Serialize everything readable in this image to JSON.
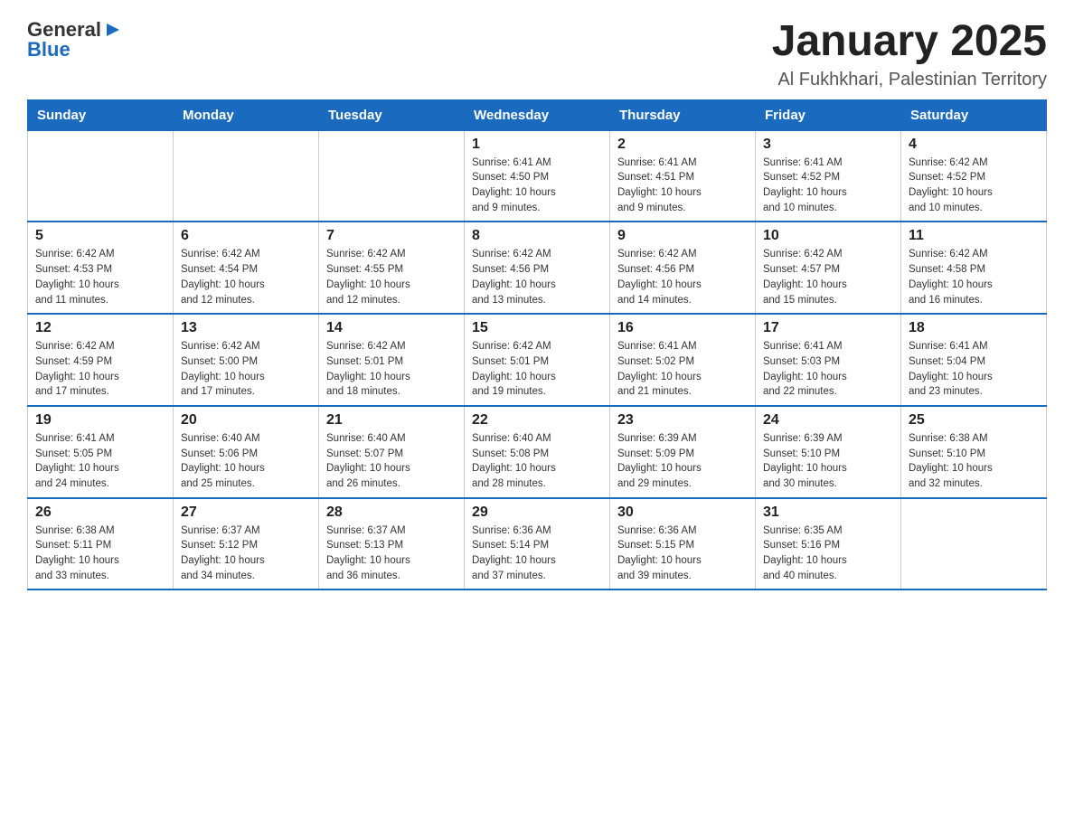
{
  "header": {
    "logo_general": "General",
    "logo_blue": "Blue",
    "month_title": "January 2025",
    "location": "Al Fukhkhari, Palestinian Territory"
  },
  "days_of_week": [
    "Sunday",
    "Monday",
    "Tuesday",
    "Wednesday",
    "Thursday",
    "Friday",
    "Saturday"
  ],
  "weeks": [
    [
      {
        "day": "",
        "info": ""
      },
      {
        "day": "",
        "info": ""
      },
      {
        "day": "",
        "info": ""
      },
      {
        "day": "1",
        "info": "Sunrise: 6:41 AM\nSunset: 4:50 PM\nDaylight: 10 hours\nand 9 minutes."
      },
      {
        "day": "2",
        "info": "Sunrise: 6:41 AM\nSunset: 4:51 PM\nDaylight: 10 hours\nand 9 minutes."
      },
      {
        "day": "3",
        "info": "Sunrise: 6:41 AM\nSunset: 4:52 PM\nDaylight: 10 hours\nand 10 minutes."
      },
      {
        "day": "4",
        "info": "Sunrise: 6:42 AM\nSunset: 4:52 PM\nDaylight: 10 hours\nand 10 minutes."
      }
    ],
    [
      {
        "day": "5",
        "info": "Sunrise: 6:42 AM\nSunset: 4:53 PM\nDaylight: 10 hours\nand 11 minutes."
      },
      {
        "day": "6",
        "info": "Sunrise: 6:42 AM\nSunset: 4:54 PM\nDaylight: 10 hours\nand 12 minutes."
      },
      {
        "day": "7",
        "info": "Sunrise: 6:42 AM\nSunset: 4:55 PM\nDaylight: 10 hours\nand 12 minutes."
      },
      {
        "day": "8",
        "info": "Sunrise: 6:42 AM\nSunset: 4:56 PM\nDaylight: 10 hours\nand 13 minutes."
      },
      {
        "day": "9",
        "info": "Sunrise: 6:42 AM\nSunset: 4:56 PM\nDaylight: 10 hours\nand 14 minutes."
      },
      {
        "day": "10",
        "info": "Sunrise: 6:42 AM\nSunset: 4:57 PM\nDaylight: 10 hours\nand 15 minutes."
      },
      {
        "day": "11",
        "info": "Sunrise: 6:42 AM\nSunset: 4:58 PM\nDaylight: 10 hours\nand 16 minutes."
      }
    ],
    [
      {
        "day": "12",
        "info": "Sunrise: 6:42 AM\nSunset: 4:59 PM\nDaylight: 10 hours\nand 17 minutes."
      },
      {
        "day": "13",
        "info": "Sunrise: 6:42 AM\nSunset: 5:00 PM\nDaylight: 10 hours\nand 17 minutes."
      },
      {
        "day": "14",
        "info": "Sunrise: 6:42 AM\nSunset: 5:01 PM\nDaylight: 10 hours\nand 18 minutes."
      },
      {
        "day": "15",
        "info": "Sunrise: 6:42 AM\nSunset: 5:01 PM\nDaylight: 10 hours\nand 19 minutes."
      },
      {
        "day": "16",
        "info": "Sunrise: 6:41 AM\nSunset: 5:02 PM\nDaylight: 10 hours\nand 21 minutes."
      },
      {
        "day": "17",
        "info": "Sunrise: 6:41 AM\nSunset: 5:03 PM\nDaylight: 10 hours\nand 22 minutes."
      },
      {
        "day": "18",
        "info": "Sunrise: 6:41 AM\nSunset: 5:04 PM\nDaylight: 10 hours\nand 23 minutes."
      }
    ],
    [
      {
        "day": "19",
        "info": "Sunrise: 6:41 AM\nSunset: 5:05 PM\nDaylight: 10 hours\nand 24 minutes."
      },
      {
        "day": "20",
        "info": "Sunrise: 6:40 AM\nSunset: 5:06 PM\nDaylight: 10 hours\nand 25 minutes."
      },
      {
        "day": "21",
        "info": "Sunrise: 6:40 AM\nSunset: 5:07 PM\nDaylight: 10 hours\nand 26 minutes."
      },
      {
        "day": "22",
        "info": "Sunrise: 6:40 AM\nSunset: 5:08 PM\nDaylight: 10 hours\nand 28 minutes."
      },
      {
        "day": "23",
        "info": "Sunrise: 6:39 AM\nSunset: 5:09 PM\nDaylight: 10 hours\nand 29 minutes."
      },
      {
        "day": "24",
        "info": "Sunrise: 6:39 AM\nSunset: 5:10 PM\nDaylight: 10 hours\nand 30 minutes."
      },
      {
        "day": "25",
        "info": "Sunrise: 6:38 AM\nSunset: 5:10 PM\nDaylight: 10 hours\nand 32 minutes."
      }
    ],
    [
      {
        "day": "26",
        "info": "Sunrise: 6:38 AM\nSunset: 5:11 PM\nDaylight: 10 hours\nand 33 minutes."
      },
      {
        "day": "27",
        "info": "Sunrise: 6:37 AM\nSunset: 5:12 PM\nDaylight: 10 hours\nand 34 minutes."
      },
      {
        "day": "28",
        "info": "Sunrise: 6:37 AM\nSunset: 5:13 PM\nDaylight: 10 hours\nand 36 minutes."
      },
      {
        "day": "29",
        "info": "Sunrise: 6:36 AM\nSunset: 5:14 PM\nDaylight: 10 hours\nand 37 minutes."
      },
      {
        "day": "30",
        "info": "Sunrise: 6:36 AM\nSunset: 5:15 PM\nDaylight: 10 hours\nand 39 minutes."
      },
      {
        "day": "31",
        "info": "Sunrise: 6:35 AM\nSunset: 5:16 PM\nDaylight: 10 hours\nand 40 minutes."
      },
      {
        "day": "",
        "info": ""
      }
    ]
  ]
}
